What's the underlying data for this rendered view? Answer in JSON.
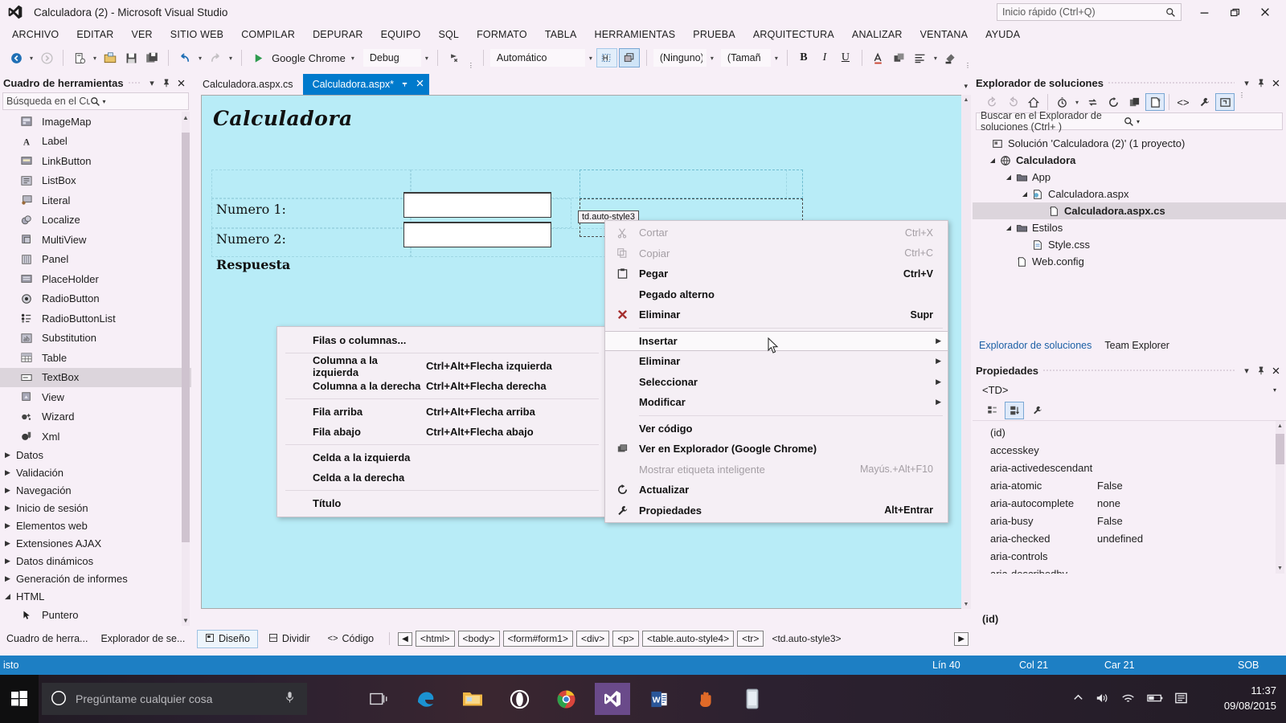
{
  "window": {
    "title": "Calculadora (2) - Microsoft Visual Studio",
    "quick_launch_placeholder": "Inicio rápido (Ctrl+Q)",
    "logo": "visual-studio-logo"
  },
  "menubar": {
    "items": [
      {
        "label": "ARCHIVO"
      },
      {
        "label": "EDITAR"
      },
      {
        "label": "VER"
      },
      {
        "label": "SITIO WEB"
      },
      {
        "label": "COMPILAR"
      },
      {
        "label": "DEPURAR"
      },
      {
        "label": "EQUIPO"
      },
      {
        "label": "SQL"
      },
      {
        "label": "FORMATO"
      },
      {
        "label": "TABLA"
      },
      {
        "label": "HERRAMIENTAS"
      },
      {
        "label": "PRUEBA"
      },
      {
        "label": "ARQUITECTURA"
      },
      {
        "label": "ANALIZAR"
      },
      {
        "label": "VENTANA"
      },
      {
        "label": "AYUDA"
      }
    ]
  },
  "toolbar": {
    "run_label": "Google Chrome",
    "config_label": "Debug",
    "block_format": "Automático",
    "style_none": "(Ninguno)",
    "font_size": "(Tamañ",
    "bold": "B",
    "italic": "I",
    "underline": "U"
  },
  "toolbox": {
    "title": "Cuadro de herramientas",
    "search_placeholder": "Búsqueda en el Cuadro de herrar",
    "items": [
      {
        "label": "ImageMap",
        "icon": "imagemap-icon",
        "selected": false
      },
      {
        "label": "Label",
        "icon": "label-icon",
        "selected": false
      },
      {
        "label": "LinkButton",
        "icon": "linkbutton-icon",
        "selected": false
      },
      {
        "label": "ListBox",
        "icon": "listbox-icon",
        "selected": false
      },
      {
        "label": "Literal",
        "icon": "literal-icon",
        "selected": false
      },
      {
        "label": "Localize",
        "icon": "localize-icon",
        "selected": false
      },
      {
        "label": "MultiView",
        "icon": "multiview-icon",
        "selected": false
      },
      {
        "label": "Panel",
        "icon": "panel-icon",
        "selected": false
      },
      {
        "label": "PlaceHolder",
        "icon": "placeholder-icon",
        "selected": false
      },
      {
        "label": "RadioButton",
        "icon": "radiobutton-icon",
        "selected": false
      },
      {
        "label": "RadioButtonList",
        "icon": "radiobuttonlist-icon",
        "selected": false
      },
      {
        "label": "Substitution",
        "icon": "substitution-icon",
        "selected": false
      },
      {
        "label": "Table",
        "icon": "table-icon",
        "selected": false
      },
      {
        "label": "TextBox",
        "icon": "textbox-icon",
        "selected": true
      },
      {
        "label": "View",
        "icon": "view-icon",
        "selected": false
      },
      {
        "label": "Wizard",
        "icon": "wizard-icon",
        "selected": false
      },
      {
        "label": "Xml",
        "icon": "xml-icon",
        "selected": false
      }
    ],
    "categories": [
      {
        "label": "Datos",
        "expanded": false
      },
      {
        "label": "Validación",
        "expanded": false
      },
      {
        "label": "Navegación",
        "expanded": false
      },
      {
        "label": "Inicio de sesión",
        "expanded": false
      },
      {
        "label": "Elementos web",
        "expanded": false
      },
      {
        "label": "Extensiones AJAX",
        "expanded": false
      },
      {
        "label": "Datos dinámicos",
        "expanded": false
      },
      {
        "label": "Generación de informes",
        "expanded": false
      },
      {
        "label": "HTML",
        "expanded": true
      }
    ],
    "html_items": [
      {
        "label": "Puntero",
        "icon": "pointer-icon"
      }
    ]
  },
  "left_tabs": [
    {
      "label": "Cuadro de herra..."
    },
    {
      "label": "Explorador de se..."
    }
  ],
  "doc_tabs": [
    {
      "label": "Calculadora.aspx.cs",
      "active": false,
      "dirty": false
    },
    {
      "label": "Calculadora.aspx*",
      "active": true,
      "dirty": true
    }
  ],
  "designer": {
    "heading": "Calculadora",
    "rows": [
      {
        "label": "Numero 1:"
      },
      {
        "label": "Numero 2:"
      },
      {
        "label": "Respuesta"
      }
    ],
    "tag_badge": "td.auto-style3"
  },
  "view_buttons": [
    {
      "label": "Diseño",
      "icon": "design-view-icon",
      "active": true
    },
    {
      "label": "Dividir",
      "icon": "split-view-icon",
      "active": false
    },
    {
      "label": "Código",
      "icon": "code-view-icon",
      "active": false
    }
  ],
  "breadcrumb": [
    {
      "label": "<html>"
    },
    {
      "label": "<body>"
    },
    {
      "label": "<form#form1>"
    },
    {
      "label": "<div>"
    },
    {
      "label": "<p>"
    },
    {
      "label": "<table.auto-style4>"
    },
    {
      "label": "<tr>"
    },
    {
      "label": "<td.auto-style3>"
    }
  ],
  "solution_explorer": {
    "title": "Explorador de soluciones",
    "search_placeholder": "Buscar en el Explorador de soluciones (Ctrl+ )",
    "tree": [
      {
        "label": "Solución 'Calculadora (2)'  (1 proyecto)",
        "depth": 0,
        "icon": "solution-icon",
        "expander": "",
        "selected": false,
        "bold": false
      },
      {
        "label": "Calculadora",
        "depth": 1,
        "icon": "web-project-icon",
        "expander": "expanded",
        "selected": false,
        "bold": true
      },
      {
        "label": "App",
        "depth": 2,
        "icon": "folder-icon",
        "expander": "expanded",
        "selected": false,
        "bold": false
      },
      {
        "label": "Calculadora.aspx",
        "depth": 3,
        "icon": "aspx-icon",
        "expander": "expanded",
        "selected": false,
        "bold": false
      },
      {
        "label": "Calculadora.aspx.cs",
        "depth": 4,
        "icon": "cs-file-icon",
        "expander": "",
        "selected": true,
        "bold": true
      },
      {
        "label": "Estilos",
        "depth": 2,
        "icon": "folder-icon",
        "expander": "expanded",
        "selected": false,
        "bold": false
      },
      {
        "label": "Style.css",
        "depth": 3,
        "icon": "css-file-icon",
        "expander": "",
        "selected": false,
        "bold": false
      },
      {
        "label": "Web.config",
        "depth": 2,
        "icon": "config-file-icon",
        "expander": "",
        "selected": false,
        "bold": false
      }
    ],
    "tabs": [
      {
        "label": "Explorador de soluciones",
        "active": true
      },
      {
        "label": "Team Explorer",
        "active": false
      }
    ]
  },
  "properties": {
    "title": "Propiedades",
    "object": "<TD>",
    "footer": "(id)",
    "rows": [
      {
        "name": "(id)",
        "value": ""
      },
      {
        "name": "accesskey",
        "value": ""
      },
      {
        "name": "aria-activedescendant",
        "value": ""
      },
      {
        "name": "aria-atomic",
        "value": "False"
      },
      {
        "name": "aria-autocomplete",
        "value": "none"
      },
      {
        "name": "aria-busy",
        "value": "False"
      },
      {
        "name": "aria-checked",
        "value": "undefined"
      },
      {
        "name": "aria-controls",
        "value": ""
      },
      {
        "name": "aria-describedby",
        "value": ""
      }
    ]
  },
  "context_menu": {
    "items": [
      {
        "label": "Cortar",
        "shortcut": "Ctrl+X",
        "icon": "cut-icon",
        "disabled": true,
        "submenu": false,
        "highlight": false
      },
      {
        "label": "Copiar",
        "shortcut": "Ctrl+C",
        "icon": "copy-icon",
        "disabled": true,
        "submenu": false,
        "highlight": false
      },
      {
        "label": "Pegar",
        "shortcut": "Ctrl+V",
        "icon": "paste-icon",
        "disabled": false,
        "submenu": false,
        "highlight": false
      },
      {
        "label": "Pegado alterno",
        "shortcut": "",
        "icon": "",
        "disabled": false,
        "submenu": false,
        "highlight": false
      },
      {
        "label": "Eliminar",
        "shortcut": "Supr",
        "icon": "delete-x-icon",
        "disabled": false,
        "submenu": false,
        "highlight": false
      },
      {
        "sep": true
      },
      {
        "label": "Insertar",
        "shortcut": "",
        "icon": "",
        "disabled": false,
        "submenu": true,
        "highlight": true
      },
      {
        "label": "Eliminar",
        "shortcut": "",
        "icon": "",
        "disabled": false,
        "submenu": true,
        "highlight": false
      },
      {
        "label": "Seleccionar",
        "shortcut": "",
        "icon": "",
        "disabled": false,
        "submenu": true,
        "highlight": false
      },
      {
        "label": "Modificar",
        "shortcut": "",
        "icon": "",
        "disabled": false,
        "submenu": true,
        "highlight": false
      },
      {
        "sep": true
      },
      {
        "label": "Ver código",
        "shortcut": "",
        "icon": "",
        "disabled": false,
        "submenu": false,
        "highlight": false
      },
      {
        "label": "Ver en Explorador (Google Chrome)",
        "shortcut": "",
        "icon": "browser-icon",
        "disabled": false,
        "submenu": false,
        "highlight": false
      },
      {
        "label": "Mostrar etiqueta inteligente",
        "shortcut": "Mayús.+Alt+F10",
        "icon": "",
        "disabled": true,
        "submenu": false,
        "highlight": false
      },
      {
        "label": "Actualizar",
        "shortcut": "",
        "icon": "refresh-icon",
        "disabled": false,
        "submenu": false,
        "highlight": false
      },
      {
        "label": "Propiedades",
        "shortcut": "Alt+Entrar",
        "icon": "wrench-icon",
        "disabled": false,
        "submenu": false,
        "highlight": false
      }
    ]
  },
  "submenu": {
    "items": [
      {
        "label": "Filas o columnas...",
        "shortcut": ""
      },
      {
        "sep": true
      },
      {
        "label": "Columna a la izquierda",
        "shortcut": "Ctrl+Alt+Flecha izquierda"
      },
      {
        "label": "Columna a la derecha",
        "shortcut": "Ctrl+Alt+Flecha derecha"
      },
      {
        "sep": true
      },
      {
        "label": "Fila arriba",
        "shortcut": "Ctrl+Alt+Flecha arriba"
      },
      {
        "label": "Fila abajo",
        "shortcut": "Ctrl+Alt+Flecha abajo"
      },
      {
        "sep": true
      },
      {
        "label": "Celda a la izquierda",
        "shortcut": ""
      },
      {
        "label": "Celda a la derecha",
        "shortcut": ""
      },
      {
        "sep": true
      },
      {
        "label": "Título",
        "shortcut": ""
      }
    ]
  },
  "status_bar": {
    "message": "isto",
    "line_label": "Lín 40",
    "col_label": "Col 21",
    "char_label": "Car 21",
    "insert_label": "SOB"
  },
  "taskbar": {
    "search_placeholder": "Pregúntame cualquier cosa",
    "apps": [
      {
        "name": "task-view-icon"
      },
      {
        "name": "edge-icon"
      },
      {
        "name": "file-explorer-icon"
      },
      {
        "name": "opera-icon"
      },
      {
        "name": "chrome-icon"
      },
      {
        "name": "visual-studio-icon"
      },
      {
        "name": "chrome-icon-2"
      },
      {
        "name": "visual-studio-icon-2"
      },
      {
        "name": "word-icon"
      },
      {
        "name": "hand-icon"
      },
      {
        "name": "phone-icon"
      }
    ],
    "time": "11:37",
    "date": "09/08/2015"
  },
  "colors": {
    "accent": "#007acc",
    "status_bar": "#1d7fc4",
    "chrome": "#f7eff7",
    "design_surface": "#b8ecf7"
  }
}
